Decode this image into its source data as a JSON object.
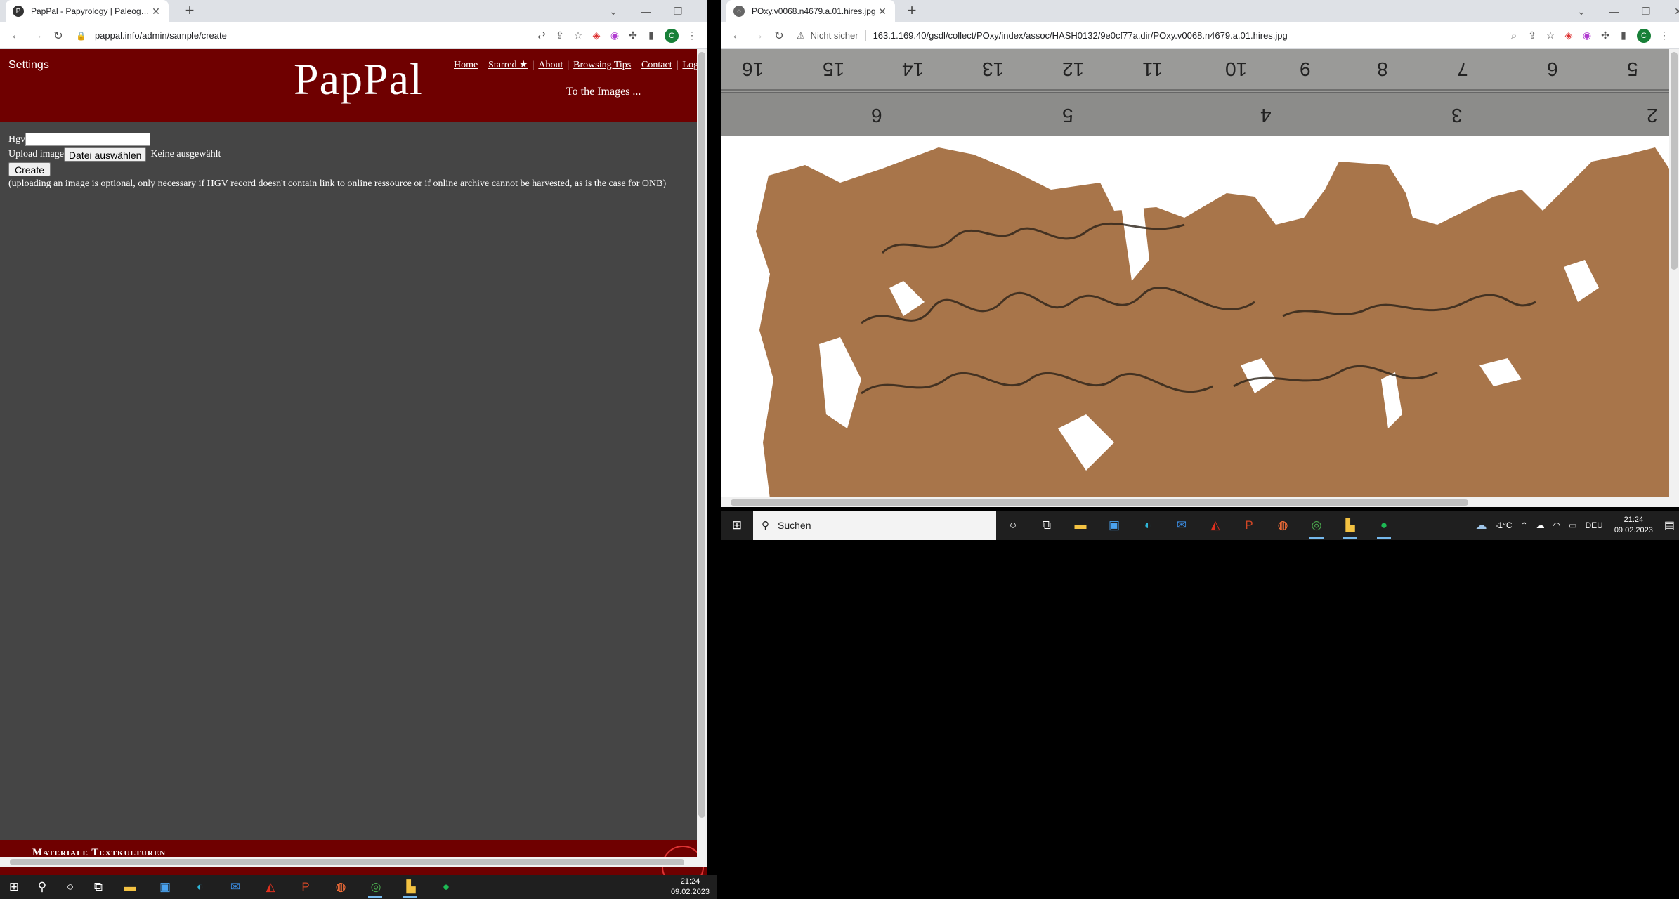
{
  "left_browser": {
    "tab_title": "PapPal - Papyrology | Paleography",
    "url": "pappal.info/admin/sample/create"
  },
  "pappal": {
    "settings": "Settings",
    "logo": "PapPal",
    "nav": [
      "Home",
      "Starred ★",
      "About",
      "Browsing Tips",
      "Contact",
      "Logou"
    ],
    "to_images": "To the Images ...",
    "form": {
      "hgv_label": "Hgv",
      "hgv_value": "",
      "upload_label": "Upload image",
      "file_button": "Datei auswählen",
      "file_status": "Keine ausgewählt",
      "create_button": "Create",
      "note": "(uploading an image is optional, only necessary if HGV record doesn't contain link to online ressource or if online archive cannot be harvested, as is the case for ONB)"
    },
    "footer_text": "Materiale Textkulturen"
  },
  "right_browser": {
    "tab_title": "POxy.v0068.n4679.a.01.hires.jpg",
    "security": "Nicht sicher",
    "url": "163.1.169.40/gsdl/collect/POxy/index/assoc/HASH0132/9e0cf77a.dir/POxy.v0068.n4679.a.01.hires.jpg"
  },
  "ruler": {
    "top_numbers": [
      "16",
      "15",
      "14",
      "13",
      "12",
      "11",
      "10",
      "9",
      "8",
      "7",
      "6",
      "5"
    ],
    "bottom_numbers": [
      "6",
      "5",
      "4",
      "3",
      "2"
    ]
  },
  "taskbar_right": {
    "search_placeholder": "Suchen",
    "weather": "-1°C",
    "language": "DEU",
    "time": "21:24",
    "date": "09.02.2023"
  },
  "taskbar_left": {
    "time": "21:24",
    "date": "09.02.2023"
  },
  "colors": {
    "pappal_red": "#6f0000",
    "page_gray": "#454545",
    "papyrus": "#a8754a"
  }
}
